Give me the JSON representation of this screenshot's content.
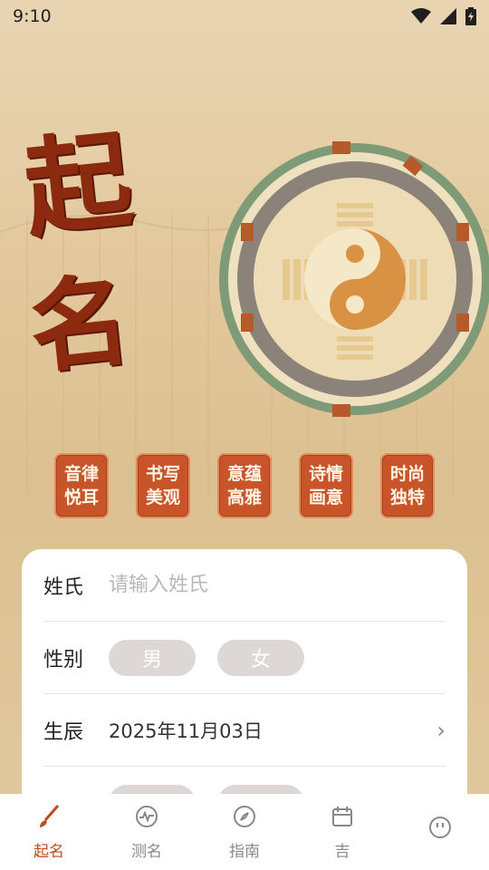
{
  "status_bar": {
    "time": "9:10",
    "icons": [
      "wifi-icon",
      "signal-icon",
      "battery-charging-icon"
    ]
  },
  "hero": {
    "title_chars": [
      "起",
      "名"
    ],
    "features": [
      {
        "line1": "音律",
        "line2": "悦耳"
      },
      {
        "line1": "书写",
        "line2": "美观"
      },
      {
        "line1": "意蕴",
        "line2": "高雅"
      },
      {
        "line1": "诗情",
        "line2": "画意"
      },
      {
        "line1": "时尚",
        "line2": "独特"
      }
    ]
  },
  "form": {
    "surname_label": "姓氏",
    "surname_placeholder": "请输入姓氏",
    "surname_value": "",
    "gender_label": "性别",
    "gender_options": [
      "男",
      "女"
    ],
    "birth_label": "生辰",
    "birth_value": "2025年11月03日"
  },
  "tabbar": {
    "tabs": [
      {
        "label": "起名",
        "icon": "brush-icon"
      },
      {
        "label": "测名",
        "icon": "pulse-chart-icon"
      },
      {
        "label": "指南",
        "icon": "compass-icon"
      },
      {
        "label": "吉",
        "icon": "calendar-icon"
      },
      {
        "label": "",
        "icon": "profile-icon"
      }
    ]
  },
  "colors": {
    "accent": "#c04a20",
    "feature_bg": "#c8552a",
    "title": "#8b2a0f"
  }
}
